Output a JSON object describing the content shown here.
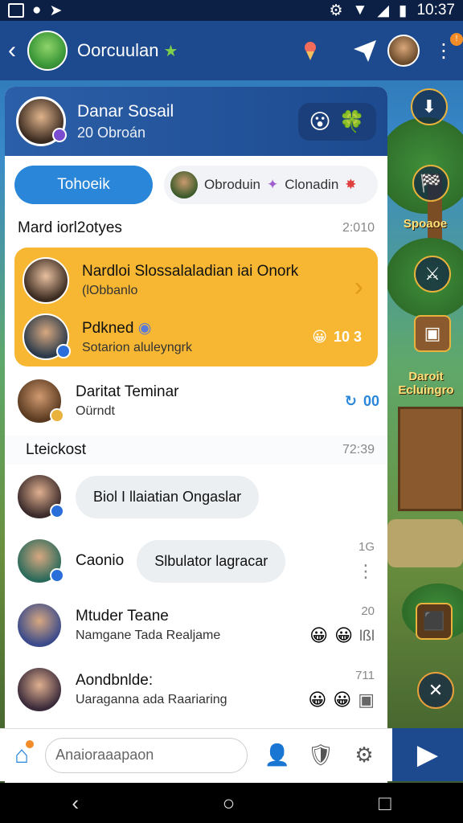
{
  "status_bar": {
    "time": "10:37"
  },
  "app_bar": {
    "title": "Oorcuulan",
    "back_icon": "chevron-left-icon"
  },
  "profile": {
    "name": "Danar Sosail",
    "subtitle": "20 Obroán",
    "emoji1": "😮",
    "emoji2": "🍀"
  },
  "tabs": {
    "active": "Tohoeik",
    "other_label1": "Obroduin",
    "other_label2": "Clonadin"
  },
  "section1": {
    "title": "Mard iorl2otyes",
    "time": "2:010"
  },
  "highlight": {
    "row1": {
      "title": "Nardloi Slossalaladian iai Onork",
      "sub": "(lObbanlo"
    },
    "row2": {
      "title": "Pdkned",
      "sub": "Sotarion aluleyngrk",
      "emoji": "😀",
      "count": "10 3"
    }
  },
  "list1": {
    "title": "Daritat Teminar",
    "sub": "Oürndt",
    "count": "00"
  },
  "section2": {
    "title": "Lteickost",
    "time": "72:39"
  },
  "rows": [
    {
      "bubble": "Biol I llaiatian Ongaslar",
      "time": "",
      "emoji": ""
    },
    {
      "name": "Caonio",
      "bubble": "Slbulator lagracar",
      "time": "1G"
    },
    {
      "name": "Mtuder Teane",
      "sub": "Namgane Tada Realjame",
      "time": "20",
      "tag": "lßl"
    },
    {
      "name": "Aondbnlde:",
      "sub": "Uaraganna ada Raariaring",
      "time": "711",
      "tag": ""
    }
  ],
  "bottom_bar": {
    "search_placeholder": "Anaioraaapaon"
  },
  "game": {
    "side_label": "Daroit Ecluingro",
    "label_top": "Spoaoe"
  }
}
